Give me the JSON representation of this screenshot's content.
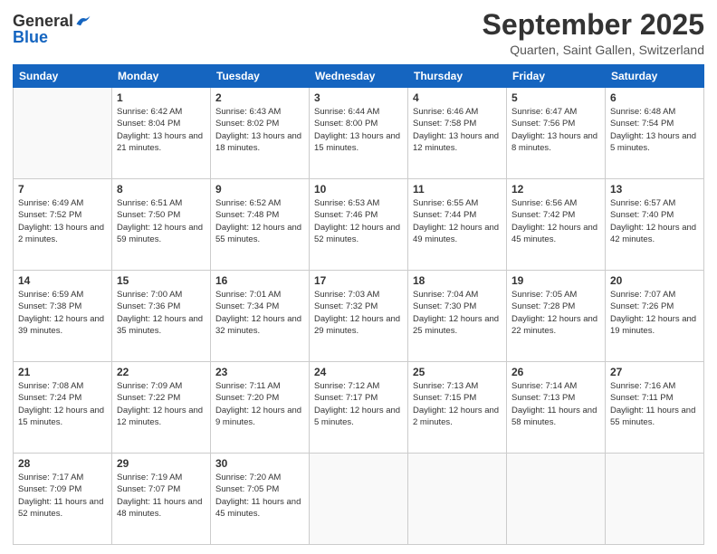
{
  "header": {
    "logo_general": "General",
    "logo_blue": "Blue",
    "month": "September 2025",
    "location": "Quarten, Saint Gallen, Switzerland"
  },
  "weekdays": [
    "Sunday",
    "Monday",
    "Tuesday",
    "Wednesday",
    "Thursday",
    "Friday",
    "Saturday"
  ],
  "weeks": [
    [
      {
        "day": "",
        "sunrise": "",
        "sunset": "",
        "daylight": ""
      },
      {
        "day": "1",
        "sunrise": "Sunrise: 6:42 AM",
        "sunset": "Sunset: 8:04 PM",
        "daylight": "Daylight: 13 hours and 21 minutes."
      },
      {
        "day": "2",
        "sunrise": "Sunrise: 6:43 AM",
        "sunset": "Sunset: 8:02 PM",
        "daylight": "Daylight: 13 hours and 18 minutes."
      },
      {
        "day": "3",
        "sunrise": "Sunrise: 6:44 AM",
        "sunset": "Sunset: 8:00 PM",
        "daylight": "Daylight: 13 hours and 15 minutes."
      },
      {
        "day": "4",
        "sunrise": "Sunrise: 6:46 AM",
        "sunset": "Sunset: 7:58 PM",
        "daylight": "Daylight: 13 hours and 12 minutes."
      },
      {
        "day": "5",
        "sunrise": "Sunrise: 6:47 AM",
        "sunset": "Sunset: 7:56 PM",
        "daylight": "Daylight: 13 hours and 8 minutes."
      },
      {
        "day": "6",
        "sunrise": "Sunrise: 6:48 AM",
        "sunset": "Sunset: 7:54 PM",
        "daylight": "Daylight: 13 hours and 5 minutes."
      }
    ],
    [
      {
        "day": "7",
        "sunrise": "Sunrise: 6:49 AM",
        "sunset": "Sunset: 7:52 PM",
        "daylight": "Daylight: 13 hours and 2 minutes."
      },
      {
        "day": "8",
        "sunrise": "Sunrise: 6:51 AM",
        "sunset": "Sunset: 7:50 PM",
        "daylight": "Daylight: 12 hours and 59 minutes."
      },
      {
        "day": "9",
        "sunrise": "Sunrise: 6:52 AM",
        "sunset": "Sunset: 7:48 PM",
        "daylight": "Daylight: 12 hours and 55 minutes."
      },
      {
        "day": "10",
        "sunrise": "Sunrise: 6:53 AM",
        "sunset": "Sunset: 7:46 PM",
        "daylight": "Daylight: 12 hours and 52 minutes."
      },
      {
        "day": "11",
        "sunrise": "Sunrise: 6:55 AM",
        "sunset": "Sunset: 7:44 PM",
        "daylight": "Daylight: 12 hours and 49 minutes."
      },
      {
        "day": "12",
        "sunrise": "Sunrise: 6:56 AM",
        "sunset": "Sunset: 7:42 PM",
        "daylight": "Daylight: 12 hours and 45 minutes."
      },
      {
        "day": "13",
        "sunrise": "Sunrise: 6:57 AM",
        "sunset": "Sunset: 7:40 PM",
        "daylight": "Daylight: 12 hours and 42 minutes."
      }
    ],
    [
      {
        "day": "14",
        "sunrise": "Sunrise: 6:59 AM",
        "sunset": "Sunset: 7:38 PM",
        "daylight": "Daylight: 12 hours and 39 minutes."
      },
      {
        "day": "15",
        "sunrise": "Sunrise: 7:00 AM",
        "sunset": "Sunset: 7:36 PM",
        "daylight": "Daylight: 12 hours and 35 minutes."
      },
      {
        "day": "16",
        "sunrise": "Sunrise: 7:01 AM",
        "sunset": "Sunset: 7:34 PM",
        "daylight": "Daylight: 12 hours and 32 minutes."
      },
      {
        "day": "17",
        "sunrise": "Sunrise: 7:03 AM",
        "sunset": "Sunset: 7:32 PM",
        "daylight": "Daylight: 12 hours and 29 minutes."
      },
      {
        "day": "18",
        "sunrise": "Sunrise: 7:04 AM",
        "sunset": "Sunset: 7:30 PM",
        "daylight": "Daylight: 12 hours and 25 minutes."
      },
      {
        "day": "19",
        "sunrise": "Sunrise: 7:05 AM",
        "sunset": "Sunset: 7:28 PM",
        "daylight": "Daylight: 12 hours and 22 minutes."
      },
      {
        "day": "20",
        "sunrise": "Sunrise: 7:07 AM",
        "sunset": "Sunset: 7:26 PM",
        "daylight": "Daylight: 12 hours and 19 minutes."
      }
    ],
    [
      {
        "day": "21",
        "sunrise": "Sunrise: 7:08 AM",
        "sunset": "Sunset: 7:24 PM",
        "daylight": "Daylight: 12 hours and 15 minutes."
      },
      {
        "day": "22",
        "sunrise": "Sunrise: 7:09 AM",
        "sunset": "Sunset: 7:22 PM",
        "daylight": "Daylight: 12 hours and 12 minutes."
      },
      {
        "day": "23",
        "sunrise": "Sunrise: 7:11 AM",
        "sunset": "Sunset: 7:20 PM",
        "daylight": "Daylight: 12 hours and 9 minutes."
      },
      {
        "day": "24",
        "sunrise": "Sunrise: 7:12 AM",
        "sunset": "Sunset: 7:17 PM",
        "daylight": "Daylight: 12 hours and 5 minutes."
      },
      {
        "day": "25",
        "sunrise": "Sunrise: 7:13 AM",
        "sunset": "Sunset: 7:15 PM",
        "daylight": "Daylight: 12 hours and 2 minutes."
      },
      {
        "day": "26",
        "sunrise": "Sunrise: 7:14 AM",
        "sunset": "Sunset: 7:13 PM",
        "daylight": "Daylight: 11 hours and 58 minutes."
      },
      {
        "day": "27",
        "sunrise": "Sunrise: 7:16 AM",
        "sunset": "Sunset: 7:11 PM",
        "daylight": "Daylight: 11 hours and 55 minutes."
      }
    ],
    [
      {
        "day": "28",
        "sunrise": "Sunrise: 7:17 AM",
        "sunset": "Sunset: 7:09 PM",
        "daylight": "Daylight: 11 hours and 52 minutes."
      },
      {
        "day": "29",
        "sunrise": "Sunrise: 7:19 AM",
        "sunset": "Sunset: 7:07 PM",
        "daylight": "Daylight: 11 hours and 48 minutes."
      },
      {
        "day": "30",
        "sunrise": "Sunrise: 7:20 AM",
        "sunset": "Sunset: 7:05 PM",
        "daylight": "Daylight: 11 hours and 45 minutes."
      },
      {
        "day": "",
        "sunrise": "",
        "sunset": "",
        "daylight": ""
      },
      {
        "day": "",
        "sunrise": "",
        "sunset": "",
        "daylight": ""
      },
      {
        "day": "",
        "sunrise": "",
        "sunset": "",
        "daylight": ""
      },
      {
        "day": "",
        "sunrise": "",
        "sunset": "",
        "daylight": ""
      }
    ]
  ]
}
